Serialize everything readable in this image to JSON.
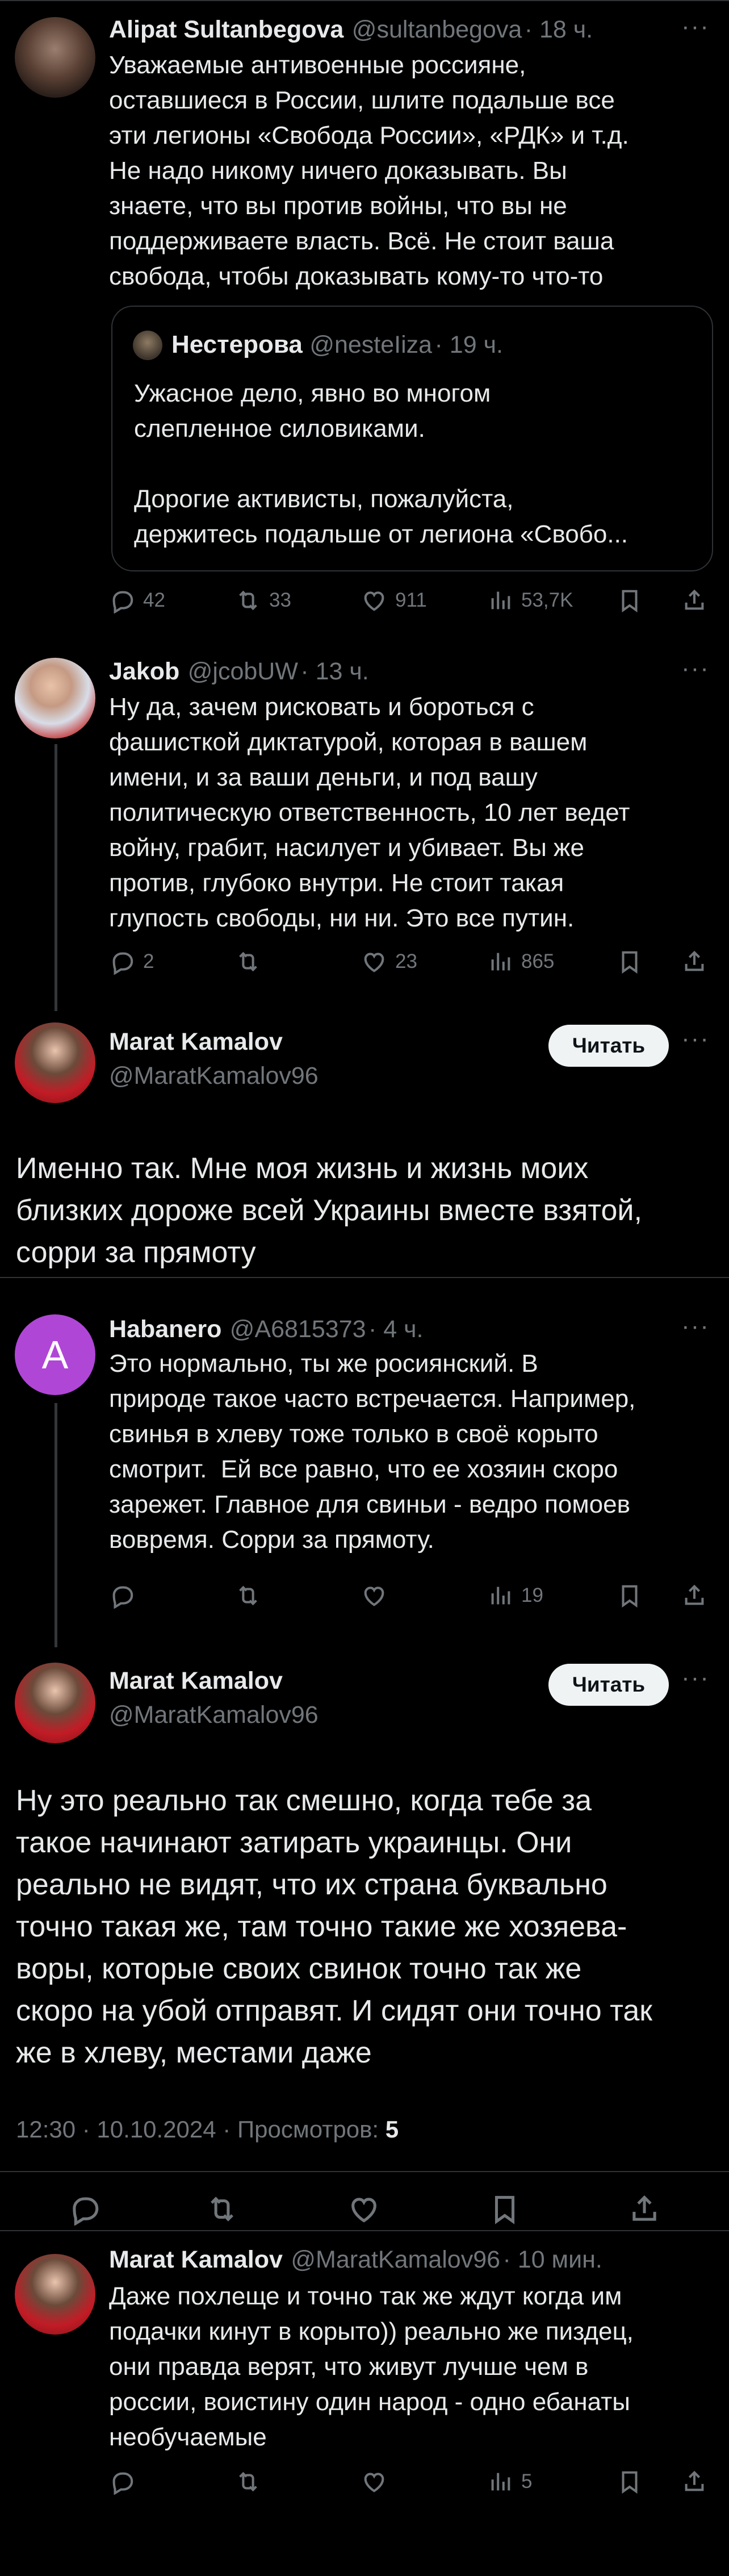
{
  "tweet1": {
    "name": "Alipat Sultanbegova",
    "handle": "@sultanbegova",
    "time": "· 18 ч.",
    "text": "Уважаемые антивоенные россияне,\nоставшиеся в России, шлите подальше все\nэти легионы «Свобода России», «РДК» и т.д.\nНе надо никому ничего доказывать. Вы\nзнаете, что вы против войны, что вы не\nподдерживаете власть. Всё. Не стоит ваша\nсвобода, чтобы доказывать кому-то что-то",
    "quote": {
      "name": "Нестерова",
      "handle": "@nesteIiza",
      "time": "· 19 ч.",
      "text": "Ужасное дело, явно во многом\nслепленное силовиками.\n\nДорогие активисты, пожалуйста,\nдержитесь подальше от легиона «Свобо..."
    },
    "replies": "42",
    "retweets": "33",
    "likes": "911",
    "views": "53,7K"
  },
  "tweet2": {
    "name": "Jakob",
    "handle": "@jcobUW",
    "time": "· 13 ч.",
    "text": "Ну да, зачем рисковать и бороться с\nфашисткой диктатурой, которая в вашем\nимени, и за ваши деньги, и под вашу\nполитическую ответственность, 10 лет ведет\nвойну, грабит, насилует и убивает. Вы же\nпротив, глубоко внутри. Не стоит такая\nглупость свободы, ни ни. Это все путин.",
    "replies": "2",
    "retweets": "",
    "likes": "23",
    "views": "865"
  },
  "tweet3": {
    "name": "Marat Kamalov",
    "handle": "@MaratKamalov96",
    "follow": "Читать",
    "text": "Именно так. Мне моя жизнь и жизнь моих\nблизких дороже всей Украины вместе взятой,\nсорри за прямоту"
  },
  "tweet4": {
    "avatar_letter": "A",
    "name": "Habanero",
    "handle": "@A6815373",
    "time": "· 4 ч.",
    "text": "Это нормально, ты же росиянский. В\nприроде такое часто встречается. Например,\nсвинья в хлеву тоже только в своё корыто\nсмотрит.  Ей все равно, что ее хозяин скоро\nзарежет. Главное для свиньи - ведро помоев\nвовремя. Сорри за прямоту.",
    "views": "19"
  },
  "tweet5": {
    "name": "Marat Kamalov",
    "handle": "@MaratKamalov96",
    "follow": "Читать",
    "text": "Ну это реально так смешно, когда тебе за\nтакое начинают затирать украинцы. Они\nреально не видят, что их страна буквально\nточно такая же, там точно такие же хозяева-\nворы, которые своих свинок точно так же\nскоро на убой отправят. И сидят они точно так\nже в хлеву, местами даже",
    "meta": "12:30 · 10.10.2024 · Просмотров: ",
    "views_count": "5"
  },
  "tweet6": {
    "name": "Marat Kamalov",
    "handle": "@MaratKamalov96",
    "time": "· 10 мин.",
    "text": "Даже похлеще и точно так же ждут когда им\nподачки кинут в корыто)) реально же пиздец,\nони правда верят, что живут лучше чем в\nроссии, воистину один народ - одно ебанаты\nнеобучаемые",
    "views": "5"
  },
  "colors": {
    "background": "#000000",
    "text": "#e7e9ea",
    "secondary": "#71767b",
    "border": "#2f3336",
    "habanero_avatar": "#b046d6"
  },
  "icons": [
    "reply-icon",
    "retweet-icon",
    "like-icon",
    "views-icon",
    "bookmark-icon",
    "share-icon",
    "more-icon"
  ]
}
